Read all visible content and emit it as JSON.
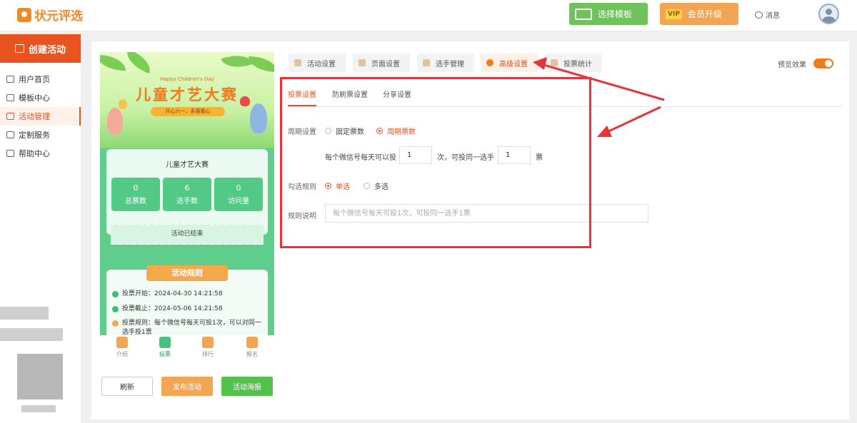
{
  "header": {
    "logo_text": "状元评选",
    "template_btn": "选择模板",
    "vip_badge": "VIP",
    "vip_btn": "会员升级",
    "message": "消息"
  },
  "sidebar": {
    "create_btn": "创建活动",
    "items": [
      {
        "label": "用户首页",
        "icon": "home-icon"
      },
      {
        "label": "模板中心",
        "icon": "folder-icon"
      },
      {
        "label": "活动管理",
        "icon": "ticket-icon"
      },
      {
        "label": "定制服务",
        "icon": "service-icon"
      },
      {
        "label": "帮助中心",
        "icon": "help-icon"
      }
    ],
    "active_index": 2
  },
  "phone": {
    "banner_en": "Happy Children's Day",
    "banner_title": "儿童才艺大赛",
    "banner_sub": "开心六一，永葆童心",
    "card_title": "儿童才艺大赛",
    "stats": [
      {
        "num": "0",
        "label": "总票数"
      },
      {
        "num": "6",
        "label": "选手数"
      },
      {
        "num": "0",
        "label": "访问量"
      }
    ],
    "ended": "活动已结束",
    "rules_head": "活动规则",
    "rules": [
      "投票开始：2024-04-30 14:21:58",
      "投票截止：2024-05-06 14:21:58",
      "投票规则：每个微信号每天可投1次，可以对同一选手投1票"
    ],
    "tabs": [
      "介绍",
      "投票",
      "排行",
      "报名"
    ],
    "active_tab": 1,
    "btn_refresh": "刷新",
    "btn_publish": "发布活动",
    "btn_poster": "活动海报"
  },
  "top_tabs": [
    "活动设置",
    "页面设置",
    "选手管理",
    "高级设置",
    "投票统计"
  ],
  "top_tab_active": 3,
  "preview_label": "预览效果",
  "settings": {
    "sub_tabs": [
      "投票设置",
      "防刷票设置",
      "分享设置"
    ],
    "sub_tab_active": 0,
    "cycle_label": "周期设置",
    "cycle_options": [
      "固定票数",
      "周期票数"
    ],
    "cycle_selected": 1,
    "text_each": "每个微信号每天可以投",
    "times_value": "1",
    "text_times": "次，可投同一选手",
    "votes_value": "1",
    "text_votes": "票",
    "select_label": "勾选规则",
    "select_options": [
      "单选",
      "多选"
    ],
    "select_selected": 0,
    "desc_label": "规则说明",
    "desc_placeholder": "每个微信号每天可投1次，可投同一选手1票"
  },
  "colors": {
    "accent": "#e8531f",
    "annotation_red": "#e8333a",
    "green": "#52c24a"
  }
}
